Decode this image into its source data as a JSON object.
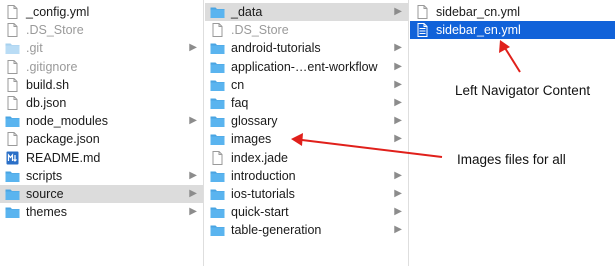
{
  "columns": [
    {
      "items": [
        {
          "label": "_config.yml",
          "type": "file",
          "chevron": false,
          "dim": false,
          "selected": ""
        },
        {
          "label": ".DS_Store",
          "type": "file",
          "chevron": false,
          "dim": true,
          "selected": ""
        },
        {
          "label": ".git",
          "type": "folder-light",
          "chevron": true,
          "dim": true,
          "selected": ""
        },
        {
          "label": ".gitignore",
          "type": "file",
          "chevron": false,
          "dim": true,
          "selected": ""
        },
        {
          "label": "build.sh",
          "type": "file",
          "chevron": false,
          "dim": false,
          "selected": ""
        },
        {
          "label": "db.json",
          "type": "file",
          "chevron": false,
          "dim": false,
          "selected": ""
        },
        {
          "label": "node_modules",
          "type": "folder",
          "chevron": true,
          "dim": false,
          "selected": ""
        },
        {
          "label": "package.json",
          "type": "file",
          "chevron": false,
          "dim": false,
          "selected": ""
        },
        {
          "label": "README.md",
          "type": "markdown",
          "chevron": false,
          "dim": false,
          "selected": ""
        },
        {
          "label": "scripts",
          "type": "folder",
          "chevron": true,
          "dim": false,
          "selected": ""
        },
        {
          "label": "source",
          "type": "folder",
          "chevron": true,
          "dim": false,
          "selected": "gray"
        },
        {
          "label": "themes",
          "type": "folder",
          "chevron": true,
          "dim": false,
          "selected": ""
        }
      ]
    },
    {
      "items": [
        {
          "label": "_data",
          "type": "folder",
          "chevron": true,
          "dim": false,
          "selected": "gray"
        },
        {
          "label": ".DS_Store",
          "type": "file",
          "chevron": false,
          "dim": true,
          "selected": ""
        },
        {
          "label": "android-tutorials",
          "type": "folder",
          "chevron": true,
          "dim": false,
          "selected": ""
        },
        {
          "label": "application-…ent-workflow",
          "type": "folder",
          "chevron": true,
          "dim": false,
          "selected": ""
        },
        {
          "label": "cn",
          "type": "folder",
          "chevron": true,
          "dim": false,
          "selected": ""
        },
        {
          "label": "faq",
          "type": "folder",
          "chevron": true,
          "dim": false,
          "selected": ""
        },
        {
          "label": "glossary",
          "type": "folder",
          "chevron": true,
          "dim": false,
          "selected": ""
        },
        {
          "label": "images",
          "type": "folder",
          "chevron": true,
          "dim": false,
          "selected": ""
        },
        {
          "label": "index.jade",
          "type": "file",
          "chevron": false,
          "dim": false,
          "selected": ""
        },
        {
          "label": "introduction",
          "type": "folder",
          "chevron": true,
          "dim": false,
          "selected": ""
        },
        {
          "label": "ios-tutorials",
          "type": "folder",
          "chevron": true,
          "dim": false,
          "selected": ""
        },
        {
          "label": "quick-start",
          "type": "folder",
          "chevron": true,
          "dim": false,
          "selected": ""
        },
        {
          "label": "table-generation",
          "type": "folder",
          "chevron": true,
          "dim": false,
          "selected": ""
        }
      ]
    },
    {
      "items": [
        {
          "label": "sidebar_cn.yml",
          "type": "file",
          "chevron": false,
          "dim": false,
          "selected": ""
        },
        {
          "label": "sidebar_en.yml",
          "type": "file",
          "chevron": false,
          "dim": false,
          "selected": "blue"
        }
      ]
    }
  ],
  "annotations": {
    "left_navigator": "Left Navigator Content",
    "images_files": "Images files for all"
  },
  "colors": {
    "selection_blue": "#1162d9",
    "selection_gray": "#dcdcdc",
    "folder_blue": "#5ab4ef",
    "arrow_red": "#e0201b"
  },
  "icons": {
    "folder": "folder-icon",
    "file": "document-icon",
    "markdown": "markdown-icon",
    "chevron": "chevron-right-icon"
  }
}
